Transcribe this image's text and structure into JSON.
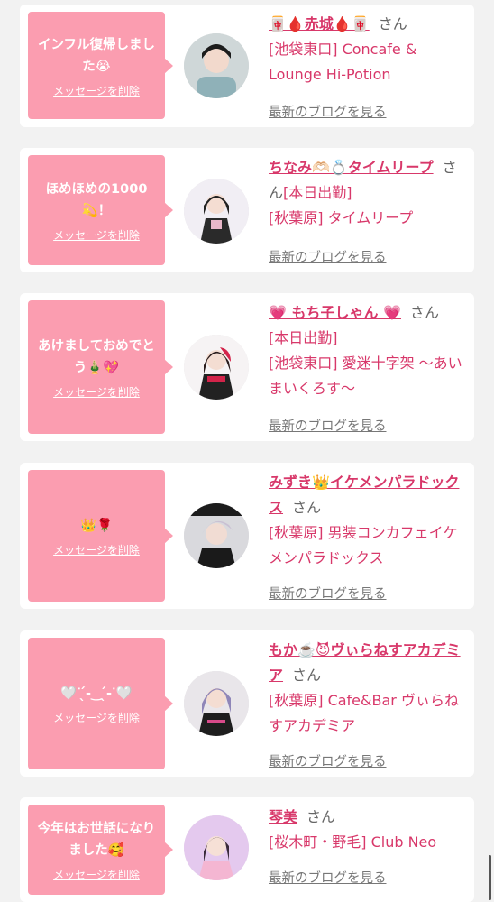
{
  "delete_label": "メッセージを削除",
  "blog_label": "最新のブログを見る",
  "san_label": "さん",
  "cards": [
    {
      "message": "インフル復帰しました😭",
      "name": "🀄🩸赤城🩸🀄",
      "status": "",
      "shop": "[池袋東口] Concafe & Lounge Hi-Potion"
    },
    {
      "message": "ほめほめの1000💫！",
      "name": "ちなみ🫶🏻💍タイムリープ",
      "status": "[本日出勤]",
      "shop": "[秋葉原] タイムリープ"
    },
    {
      "message": "あけましておめでとう🎍💖",
      "name": "💗 もち子しゃん 💗",
      "status": "[本日出勤]",
      "shop": "[池袋東口] 愛迷十字架 〜あいまいくろす〜"
    },
    {
      "message": "👑🌹",
      "name": "みずき👑イケメンパラドックス",
      "status": "",
      "shop": "[秋葉原] 男装コンカフェイケメンパラドックス"
    },
    {
      "message": "🤍ᐝ ̖́-‿ ̖́-ᐝ🤍",
      "name": "もか☕️😈ヴぃらねすアカデミア",
      "status": "",
      "shop": "[秋葉原] Cafe&Bar ヴぃらねすアカデミア"
    },
    {
      "message": "今年はお世話になりました🥰",
      "name": "琴美",
      "status": "",
      "shop": "[桜木町・野毛] Club Neo"
    }
  ]
}
